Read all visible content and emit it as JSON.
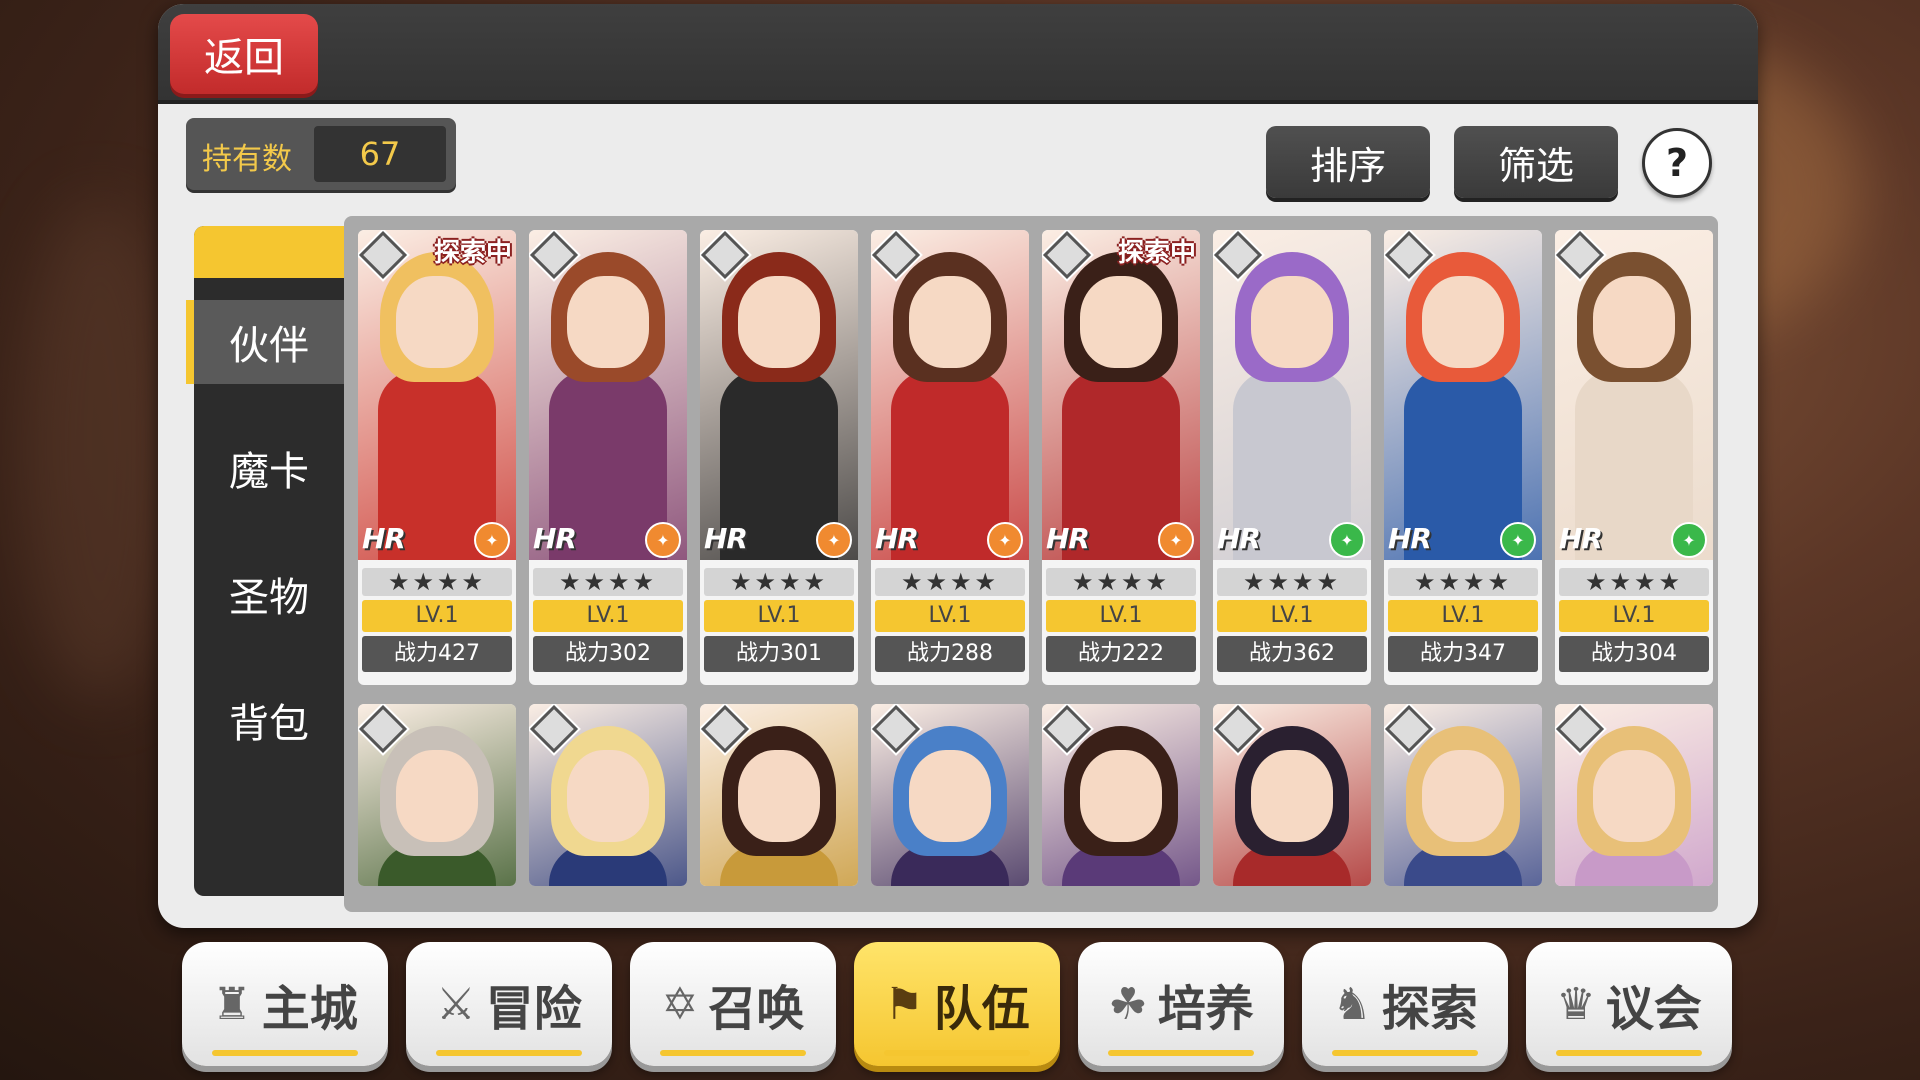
{
  "header": {
    "back_label": "返回"
  },
  "owned": {
    "label": "持有数",
    "value": "67"
  },
  "toolbar": {
    "sort_label": "排序",
    "filter_label": "筛选",
    "help_label": "?"
  },
  "tabs": [
    {
      "label": "伙伴",
      "active": true
    },
    {
      "label": "魔卡",
      "active": false
    },
    {
      "label": "圣物",
      "active": false
    },
    {
      "label": "背包",
      "active": false
    }
  ],
  "cards_row1": [
    {
      "tag": "探索中",
      "rarity": "HR",
      "stars": "★★★★",
      "level": "LV.1",
      "power": "战力427",
      "element_icon": "atk-icon",
      "element_color": "#f08a30",
      "hair": "#f0c060",
      "outfit": "#c8302a"
    },
    {
      "tag": "",
      "rarity": "HR",
      "stars": "★★★★",
      "level": "LV.1",
      "power": "战力302",
      "element_icon": "atk-icon",
      "element_color": "#f08a30",
      "hair": "#9a4a2a",
      "outfit": "#7a3a6a"
    },
    {
      "tag": "",
      "rarity": "HR",
      "stars": "★★★★",
      "level": "LV.1",
      "power": "战力301",
      "element_icon": "atk-icon",
      "element_color": "#f08a30",
      "hair": "#8a2a1a",
      "outfit": "#2a2a2a"
    },
    {
      "tag": "",
      "rarity": "HR",
      "stars": "★★★★",
      "level": "LV.1",
      "power": "战力288",
      "element_icon": "atk-icon",
      "element_color": "#f08a30",
      "hair": "#5a3020",
      "outfit": "#c02a2a"
    },
    {
      "tag": "探索中",
      "rarity": "HR",
      "stars": "★★★★",
      "level": "LV.1",
      "power": "战力222",
      "element_icon": "heal-icon",
      "element_color": "#f08a30",
      "hair": "#3a2018",
      "outfit": "#b0282a"
    },
    {
      "tag": "",
      "rarity": "HR",
      "stars": "★★★★",
      "level": "LV.1",
      "power": "战力362",
      "element_icon": "def-icon",
      "element_color": "#3ab84a",
      "hair": "#9a6ac8",
      "outfit": "#c8c8d0"
    },
    {
      "tag": "",
      "rarity": "HR",
      "stars": "★★★★",
      "level": "LV.1",
      "power": "战力347",
      "element_icon": "shield-icon",
      "element_color": "#3ab84a",
      "hair": "#e85a3a",
      "outfit": "#2a5aa8"
    },
    {
      "tag": "",
      "rarity": "HR",
      "stars": "★★★★",
      "level": "LV.1",
      "power": "战力304",
      "element_icon": "def-icon",
      "element_color": "#3ab84a",
      "hair": "#7a5030",
      "outfit": "#e8d8c8"
    }
  ],
  "cards_row2": [
    {
      "hair": "#c8c0b8",
      "outfit": "#3a5a2a"
    },
    {
      "hair": "#f0d890",
      "outfit": "#2a3a78"
    },
    {
      "hair": "#3a2018",
      "outfit": "#c89a3a"
    },
    {
      "hair": "#4a80c8",
      "outfit": "#3a2a5a"
    },
    {
      "hair": "#3a2018",
      "outfit": "#5a3a78"
    },
    {
      "hair": "#2a2030",
      "outfit": "#a82a2a"
    },
    {
      "hair": "#e8c078",
      "outfit": "#3a4a8a"
    },
    {
      "hair": "#e8c078",
      "outfit": "#c89ac8"
    }
  ],
  "bottom_nav": [
    {
      "label": "主城",
      "icon": "castle-icon",
      "glyph": "♜",
      "active": false
    },
    {
      "label": "冒险",
      "icon": "swords-icon",
      "glyph": "⚔",
      "active": false
    },
    {
      "label": "召唤",
      "icon": "hexagram-icon",
      "glyph": "✡",
      "active": false
    },
    {
      "label": "队伍",
      "icon": "team-icon",
      "glyph": "⚑",
      "active": true
    },
    {
      "label": "培养",
      "icon": "nurture-icon",
      "glyph": "☘",
      "active": false
    },
    {
      "label": "探索",
      "icon": "explore-icon",
      "glyph": "♞",
      "active": false
    },
    {
      "label": "议会",
      "icon": "council-icon",
      "glyph": "♛",
      "active": false
    }
  ]
}
